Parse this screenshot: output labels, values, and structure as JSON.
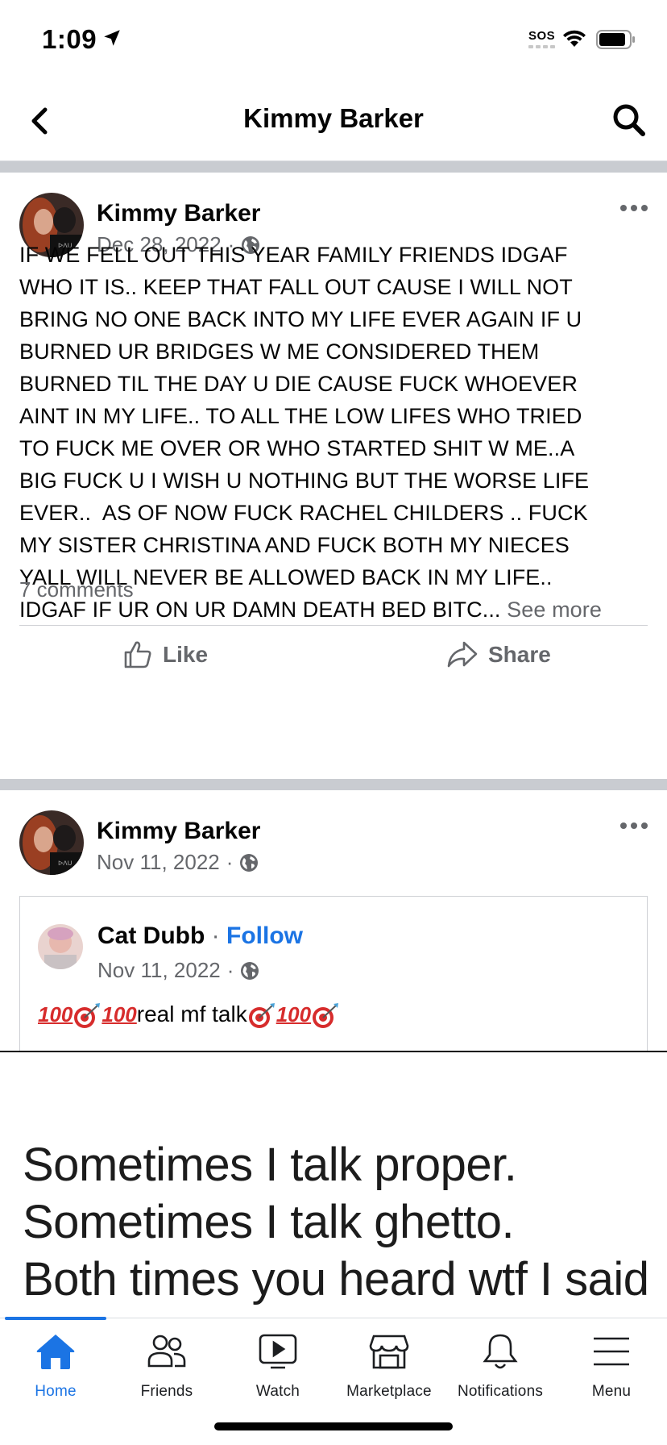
{
  "status_bar": {
    "time": "1:09",
    "sos": "SOS"
  },
  "header": {
    "title": "Kimmy Barker"
  },
  "posts": [
    {
      "author": "Kimmy Barker",
      "date": "Dec 28, 2022",
      "separator": "·",
      "text": "IF WE FELL OUT THIS YEAR FAMILY FRIENDS IDGAF WHO IT IS.. KEEP THAT FALL OUT CAUSE I WILL NOT BRING NO ONE BACK INTO MY LIFE EVER AGAIN IF U BURNED UR BRIDGES W ME CONSIDERED THEM BURNED TIL THE DAY U DIE CAUSE FUCK WHOEVER AINT IN MY LIFE.. TO ALL THE LOW LIFES WHO TRIED TO FUCK ME OVER OR WHO STARTED SHIT W ME..A BIG FUCK U I WISH U NOTHING BUT THE WORSE LIFE EVER..  AS OF NOW FUCK RACHEL CHILDERS .. FUCK MY SISTER CHRISTINA AND FUCK BOTH MY NIECES YALL WILL NEVER BE ALLOWED BACK IN MY LIFE.. IDGAF IF UR ON UR DAMN DEATH BED BITC...",
      "text_lines": [
        "IF WE FELL OUT THIS YEAR FAMILY FRIENDS IDGAF",
        "WHO IT IS.. KEEP THAT FALL OUT CAUSE I WILL NOT",
        "BRING NO ONE BACK INTO MY LIFE EVER AGAIN IF U",
        "BURNED UR BRIDGES W ME CONSIDERED THEM",
        "BURNED TIL THE DAY U DIE CAUSE FUCK WHOEVER",
        "AINT IN MY LIFE.. TO ALL THE LOW LIFES WHO TRIED",
        "TO FUCK ME OVER OR WHO STARTED SHIT W ME..A",
        "BIG FUCK U I WISH U NOTHING BUT THE WORSE LIFE",
        "EVER..  AS OF NOW FUCK RACHEL CHILDERS .. FUCK",
        "MY SISTER CHRISTINA AND FUCK BOTH MY NIECES",
        "YALL WILL NEVER BE ALLOWED BACK IN MY LIFE..",
        "IDGAF IF UR ON UR DAMN DEATH BED BITC..."
      ],
      "see_more": "See more",
      "comments": "7 comments",
      "like_label": "Like",
      "share_label": "Share"
    },
    {
      "author": "Kimmy Barker",
      "date": "Nov 11, 2022",
      "separator": "·",
      "shared": {
        "author": "Cat Dubb",
        "separator": "·",
        "follow_label": "Follow",
        "date": "Nov 11, 2022",
        "text": "real mf talk"
      },
      "image_text": [
        "Sometimes I talk proper.",
        "Sometimes I talk ghetto.",
        "Both times you heard wtf I said"
      ]
    }
  ],
  "tabbar": {
    "tabs": [
      {
        "label": "Home",
        "icon": "home-icon",
        "active": true
      },
      {
        "label": "Friends",
        "icon": "friends-icon"
      },
      {
        "label": "Watch",
        "icon": "watch-icon"
      },
      {
        "label": "Marketplace",
        "icon": "marketplace-icon"
      },
      {
        "label": "Notifications",
        "icon": "bell-icon"
      },
      {
        "label": "Menu",
        "icon": "menu-icon"
      }
    ],
    "active_color": "#1b74e4"
  }
}
